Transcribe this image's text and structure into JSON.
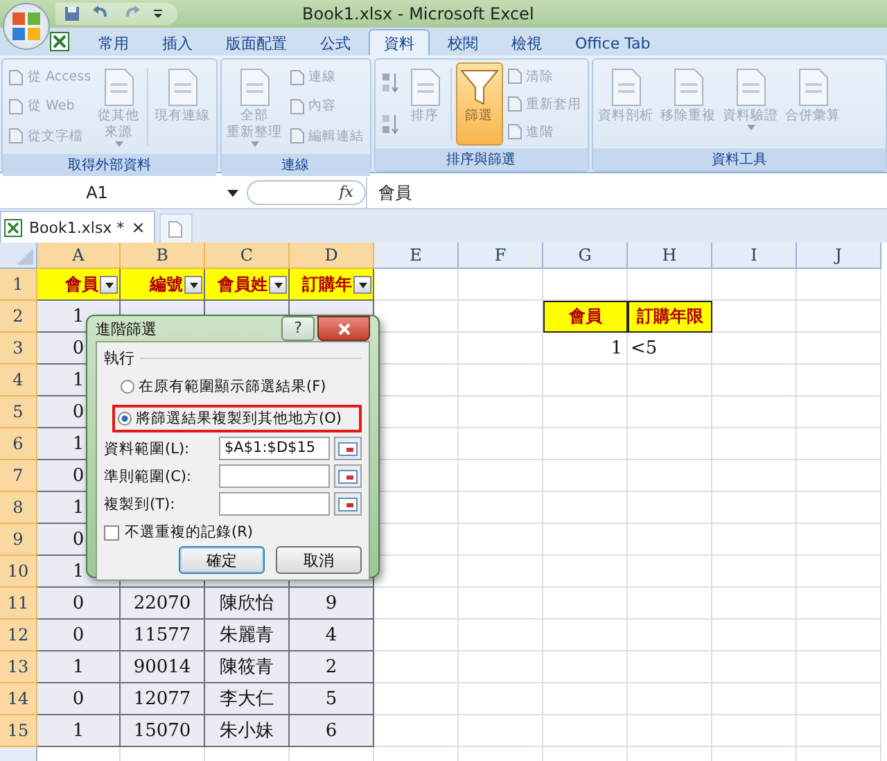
{
  "window": {
    "title": "Book1.xlsx - Microsoft Excel"
  },
  "tabs": [
    {
      "label": "常用",
      "selected": false
    },
    {
      "label": "插入",
      "selected": false
    },
    {
      "label": "版面配置",
      "selected": false
    },
    {
      "label": "公式",
      "selected": false
    },
    {
      "label": "資料",
      "selected": true
    },
    {
      "label": "校閱",
      "selected": false
    },
    {
      "label": "檢視",
      "selected": false
    },
    {
      "label": "Office Tab",
      "selected": false
    }
  ],
  "ribbon_groups": [
    {
      "label": "取得外部資料",
      "columns": [
        {
          "kind": "stack",
          "items": [
            "從 Access",
            "從 Web",
            "從文字檔"
          ]
        },
        {
          "kind": "large",
          "lines": [
            "從其他",
            "來源"
          ],
          "dropdown": true,
          "pressed": false
        },
        {
          "kind": "separator"
        },
        {
          "kind": "large",
          "lines": [
            "現有連線"
          ],
          "dropdown": false,
          "pressed": false
        }
      ]
    },
    {
      "label": "連線",
      "columns": [
        {
          "kind": "large",
          "lines": [
            "全部",
            "重新整理"
          ],
          "dropdown": true,
          "pressed": false
        },
        {
          "kind": "stack",
          "items": [
            "連線",
            "內容",
            "編輯連結"
          ]
        }
      ]
    },
    {
      "label": "排序與篩選",
      "columns": [
        {
          "kind": "sort"
        },
        {
          "kind": "large",
          "lines": [
            "排序"
          ],
          "dropdown": false,
          "pressed": false
        },
        {
          "kind": "separator"
        },
        {
          "kind": "filter",
          "lines": [
            "篩選"
          ],
          "dropdown": false,
          "pressed": true
        },
        {
          "kind": "stack",
          "items": [
            "清除",
            "重新套用",
            "進階"
          ]
        }
      ]
    },
    {
      "label": "資料工具",
      "columns": [
        {
          "kind": "large",
          "lines": [
            "資料剖析"
          ],
          "dropdown": false,
          "pressed": false
        },
        {
          "kind": "large",
          "lines": [
            "移除重複"
          ],
          "dropdown": false,
          "pressed": false
        },
        {
          "kind": "large",
          "lines": [
            "資料驗證"
          ],
          "dropdown": true,
          "pressed": false
        },
        {
          "kind": "large",
          "lines": [
            "合併彙算"
          ],
          "dropdown": false,
          "pressed": false
        }
      ]
    }
  ],
  "formula_bar": {
    "name_box": "A1",
    "function_label": "fx",
    "value": "會員"
  },
  "doc_tabs": [
    {
      "label": "Book1.xlsx *",
      "close": "×",
      "selected": true
    }
  ],
  "columns": [
    {
      "label": "A",
      "selected": true
    },
    {
      "label": "B",
      "selected": true
    },
    {
      "label": "C",
      "selected": true
    },
    {
      "label": "D",
      "selected": true
    },
    {
      "label": "E",
      "selected": false
    },
    {
      "label": "F",
      "selected": false
    },
    {
      "label": "G",
      "selected": false
    },
    {
      "label": "H",
      "selected": false
    },
    {
      "label": "I",
      "selected": false
    },
    {
      "label": "J",
      "selected": false
    }
  ],
  "rows": [
    {
      "number": "1",
      "selected": true,
      "cells": {
        "A": {
          "text": "會員",
          "kind": "filter_header"
        },
        "B": {
          "text": "編號",
          "kind": "filter_header"
        },
        "C": {
          "text": "會員姓",
          "kind": "filter_header"
        },
        "D": {
          "text": "訂購年",
          "kind": "filter_header"
        }
      }
    },
    {
      "number": "2",
      "selected": true,
      "cells": {
        "A": {
          "text": "1",
          "kind": "center"
        },
        "G": {
          "text": "會員",
          "kind": "criteria_header"
        },
        "H": {
          "text": "訂購年限",
          "kind": "criteria_header"
        }
      }
    },
    {
      "number": "3",
      "selected": true,
      "cells": {
        "A": {
          "text": "0",
          "kind": "center"
        },
        "G": {
          "text": "1",
          "kind": "right"
        },
        "H": {
          "text": "<5",
          "kind": "left"
        }
      }
    },
    {
      "number": "4",
      "selected": true,
      "cells": {
        "A": {
          "text": "1",
          "kind": "center"
        }
      }
    },
    {
      "number": "5",
      "selected": true,
      "cells": {
        "A": {
          "text": "0",
          "kind": "center"
        }
      }
    },
    {
      "number": "6",
      "selected": true,
      "cells": {
        "A": {
          "text": "1",
          "kind": "center"
        }
      }
    },
    {
      "number": "7",
      "selected": true,
      "cells": {
        "A": {
          "text": "0",
          "kind": "center"
        }
      }
    },
    {
      "number": "8",
      "selected": true,
      "cells": {
        "A": {
          "text": "1",
          "kind": "center"
        }
      }
    },
    {
      "number": "9",
      "selected": true,
      "cells": {
        "A": {
          "text": "0",
          "kind": "center"
        }
      }
    },
    {
      "number": "10",
      "selected": true,
      "cells": {
        "A": {
          "text": "1",
          "kind": "center"
        }
      }
    },
    {
      "number": "11",
      "selected": true,
      "cells": {
        "A": {
          "text": "0",
          "kind": "center"
        },
        "B": {
          "text": "22070",
          "kind": "center"
        },
        "C": {
          "text": "陳欣怡",
          "kind": "center"
        },
        "D": {
          "text": "9",
          "kind": "center"
        }
      }
    },
    {
      "number": "12",
      "selected": true,
      "cells": {
        "A": {
          "text": "0",
          "kind": "center"
        },
        "B": {
          "text": "11577",
          "kind": "center"
        },
        "C": {
          "text": "朱麗青",
          "kind": "center"
        },
        "D": {
          "text": "4",
          "kind": "center"
        }
      }
    },
    {
      "number": "13",
      "selected": true,
      "cells": {
        "A": {
          "text": "1",
          "kind": "center"
        },
        "B": {
          "text": "90014",
          "kind": "center"
        },
        "C": {
          "text": "陳筱青",
          "kind": "center"
        },
        "D": {
          "text": "2",
          "kind": "center"
        }
      }
    },
    {
      "number": "14",
      "selected": true,
      "cells": {
        "A": {
          "text": "0",
          "kind": "center"
        },
        "B": {
          "text": "12077",
          "kind": "center"
        },
        "C": {
          "text": "李大仁",
          "kind": "center"
        },
        "D": {
          "text": "5",
          "kind": "center"
        }
      }
    },
    {
      "number": "15",
      "selected": true,
      "cells": {
        "A": {
          "text": "1",
          "kind": "center"
        },
        "B": {
          "text": "15070",
          "kind": "center"
        },
        "C": {
          "text": "朱小妹",
          "kind": "center"
        },
        "D": {
          "text": "6",
          "kind": "center"
        }
      }
    }
  ],
  "dialog": {
    "title": "進階篩選",
    "help": "?",
    "section": "執行",
    "options": [
      {
        "label": "在原有範圍顯示篩選結果(F)",
        "selected": false,
        "highlighted": false
      },
      {
        "label": "將篩選結果複製到其他地方(O)",
        "selected": true,
        "highlighted": true
      }
    ],
    "fields": [
      {
        "label": "資料範圍(L):",
        "value": "$A$1:$D$15"
      },
      {
        "label": "準則範圍(C):"
      },
      {
        "label": "複製到(T):"
      }
    ],
    "checkbox": {
      "label": "不選重複的記錄(R)",
      "checked": false
    },
    "buttons": [
      {
        "label": "確定",
        "default": true
      },
      {
        "label": "取消",
        "default": false
      }
    ]
  }
}
